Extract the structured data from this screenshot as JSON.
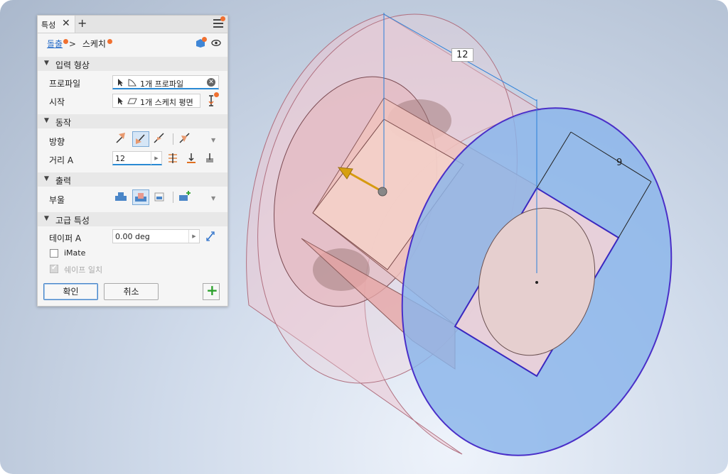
{
  "panel": {
    "tab_label": "특성",
    "tab_close": "✕",
    "tab_add": "+",
    "breadcrumb": {
      "link": "돌출",
      "separator": ">",
      "current": "스케치"
    },
    "sections": {
      "input": "입력 형상",
      "behavior": "동작",
      "output": "출력",
      "advanced": "고급 특성"
    },
    "input_geometry": {
      "profile_label": "프로파일",
      "profile_value": "1개 프로파일",
      "start_label": "시작",
      "start_value": "1개 스케치 평면"
    },
    "behavior": {
      "direction_label": "방향",
      "distance_label": "거리 A",
      "distance_value": "12"
    },
    "output": {
      "boolean_label": "부울"
    },
    "advanced": {
      "taper_label": "테이퍼 A",
      "taper_value": "0.00 deg",
      "imate_label": "iMate",
      "imate_checked": false,
      "match_shape_label": "쉐이프 일치",
      "match_shape_checked": true,
      "match_shape_enabled": false
    },
    "buttons": {
      "ok": "확인",
      "cancel": "취소",
      "add": "+"
    }
  },
  "viewport": {
    "dimension_length": "12",
    "dimension_width": "9"
  },
  "colors": {
    "accent": "#2a6fc9",
    "notification_dot": "#f07030",
    "add_green": "#2ca02c",
    "profile_blue": "#8ab4ea",
    "body_pink": "#f0c8d0"
  }
}
